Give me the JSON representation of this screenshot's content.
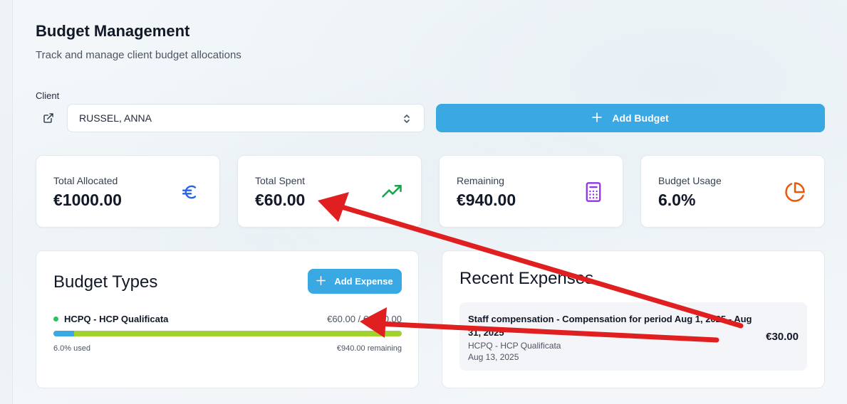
{
  "header": {
    "title": "Budget Management",
    "subtitle": "Track and manage client budget allocations"
  },
  "client": {
    "label": "Client",
    "selected": "RUSSEL, ANNA"
  },
  "buttons": {
    "add_budget": "Add Budget",
    "add_expense": "Add Expense"
  },
  "stats": [
    {
      "label": "Total Allocated",
      "value": "€1000.00",
      "icon": "euro-icon",
      "color": "#2563eb"
    },
    {
      "label": "Total Spent",
      "value": "€60.00",
      "icon": "trending-up-icon",
      "color": "#16a34a"
    },
    {
      "label": "Remaining",
      "value": "€940.00",
      "icon": "calculator-icon",
      "color": "#9333ea"
    },
    {
      "label": "Budget Usage",
      "value": "6.0%",
      "icon": "pie-chart-icon",
      "color": "#ea580c"
    }
  ],
  "budget_types": {
    "title": "Budget Types",
    "items": [
      {
        "name": "HCPQ - HCP Qualificata",
        "amount": "€60.00 / €1000.00",
        "used_text": "6.0% used",
        "remaining_text": "€940.00 remaining",
        "used_fraction": 0.06
      }
    ]
  },
  "recent_expenses": {
    "title": "Recent Expenses",
    "items": [
      {
        "description": "Staff compensation - Compensation for period Aug 1, 2025 - Aug 31, 2025",
        "category": "HCPQ - HCP Qualificata",
        "date": "Aug 13, 2025",
        "amount": "€30.00"
      }
    ]
  },
  "colors": {
    "accent": "#3aa8e3",
    "bar_remaining": "#a3d12f",
    "annotation_arrow": "#e02020"
  }
}
